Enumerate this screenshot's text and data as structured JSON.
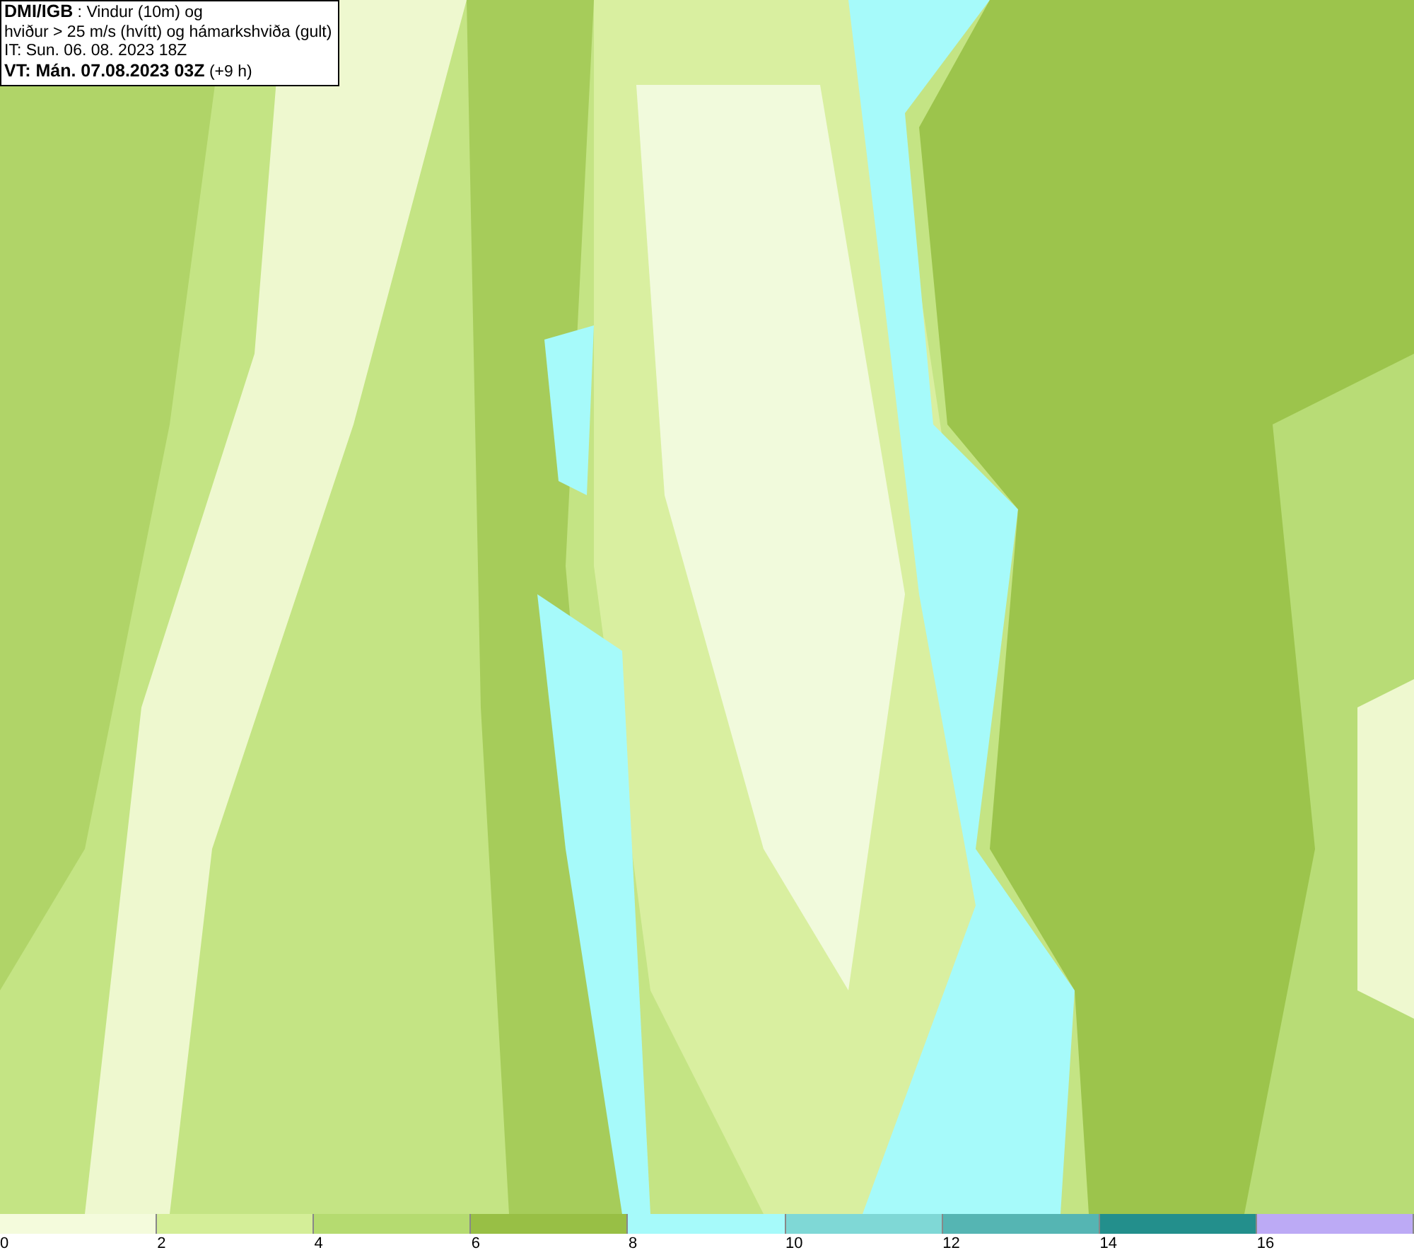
{
  "header": {
    "lines": [
      "**DMI/IGB** : Vindur (10m) og",
      "hviður > 25 m/s (hvítt) og hámarkshviða (gult)",
      "IT: Sun. 06. 08. 2023 18Z",
      "**VT: Mán. 07.08.2023 03Z** (+9 h)"
    ]
  },
  "scale": {
    "bins": [
      {
        "color": "#f4fbdc"
      },
      {
        "color": "#d4ee98"
      },
      {
        "color": "#b5db70"
      },
      {
        "color": "#98bf45"
      },
      {
        "color": "#a6fafa"
      },
      {
        "color": "#7fd8d6"
      },
      {
        "color": "#55b5b3"
      },
      {
        "color": "#238f8c"
      },
      {
        "color": "#bcaaf5"
      }
    ],
    "ticks": [
      "0",
      "2",
      "4",
      "6",
      "8",
      "10",
      "12",
      "14",
      "16"
    ]
  }
}
